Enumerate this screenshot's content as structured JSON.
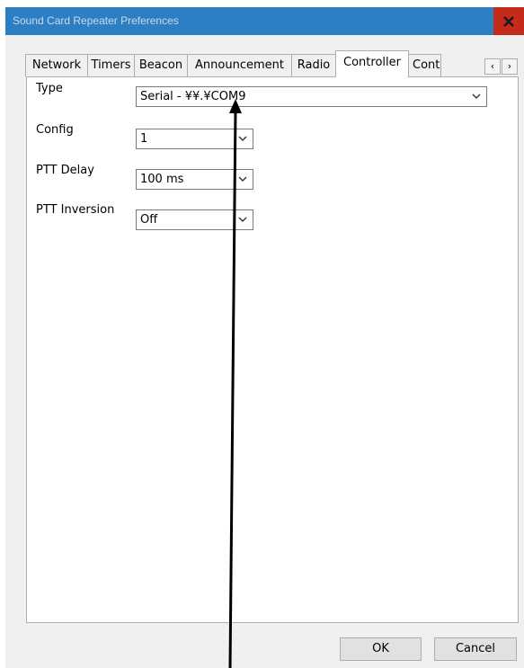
{
  "window": {
    "title": "Sound Card Repeater Preferences",
    "close_glyph": "x"
  },
  "tabs": [
    {
      "label": "Network"
    },
    {
      "label": "Timers"
    },
    {
      "label": "Beacon"
    },
    {
      "label": "Announcement"
    },
    {
      "label": "Radio"
    },
    {
      "label": "Controller",
      "active": true
    },
    {
      "label": "Cont"
    }
  ],
  "tab_scroll": {
    "left": "‹",
    "right": "›"
  },
  "controller": {
    "type": {
      "label": "Type",
      "value": "Serial - ¥¥.¥COM9"
    },
    "config": {
      "label": "Config",
      "value": "1"
    },
    "ptt_delay": {
      "label": "PTT Delay",
      "value": "100 ms"
    },
    "ptt_inversion": {
      "label": "PTT Inversion",
      "value": "Off"
    }
  },
  "buttons": {
    "ok": "OK",
    "cancel": "Cancel"
  },
  "colors": {
    "titlebar": "#2d7fc3",
    "close": "#c42b1c",
    "dialog_bg": "#f0f0f0"
  },
  "icons": {
    "close": "close-icon",
    "dropdown": "chevron-down-icon",
    "annotation": "arrow-annotation"
  }
}
